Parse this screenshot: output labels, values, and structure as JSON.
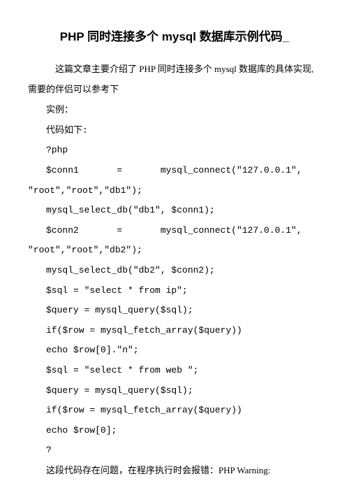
{
  "title": "PHP 同时连接多个 mysql 数据库示例代码_",
  "intro": "这篇文章主要介绍了 PHP 同时连接多个 mysql 数据库的具体实现,需要的伴侣可以参考下",
  "lines": {
    "l1": "实例：",
    "l2": "代码如下:",
    "l3": "?php",
    "l4a": "$conn1       =       mysql_connect(\"127.0.0.1\",",
    "l4b": "\"root\",\"root\",\"db1\");",
    "l5": "mysql_select_db(\"db1\", $conn1);",
    "l6a": "$conn2       =       mysql_connect(\"127.0.0.1\",",
    "l6b": "\"root\",\"root\",\"db2\");",
    "l7": "mysql_select_db(\"db2\", $conn2);",
    "l8": "$sql = \"select * from ip\";",
    "l9": "$query = mysql_query($sql);",
    "l10": "if($row = mysql_fetch_array($query))",
    "l11": "echo $row[0].\"n\";",
    "l12": "$sql = \"select * from web \";",
    "l13": "$query = mysql_query($sql);",
    "l14": "if($row = mysql_fetch_array($query))",
    "l15": "echo $row[0];",
    "l16": "?"
  },
  "footer": "这段代码存在问题，在程序执行时会报错：PHP Warning:"
}
